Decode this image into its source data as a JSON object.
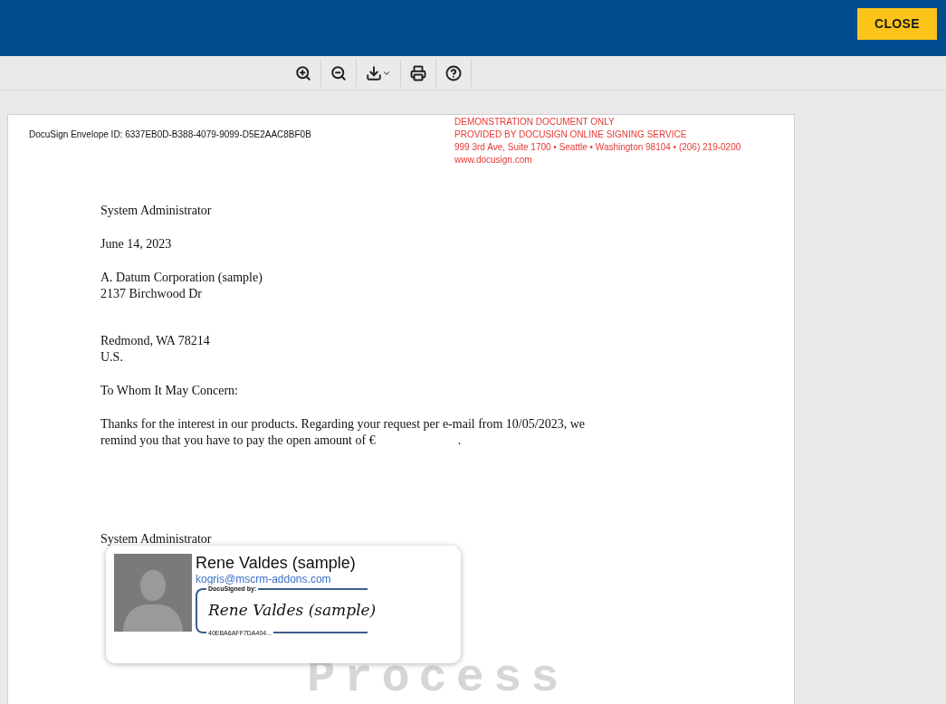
{
  "header": {
    "close_button": "CLOSE"
  },
  "toolbar": [
    {
      "kind": "zoom-in"
    },
    {
      "kind": "zoom-out"
    },
    {
      "kind": "download"
    },
    {
      "kind": "print"
    },
    {
      "kind": "help"
    }
  ],
  "document": {
    "envelope_id": "DocuSign Envelope ID: 6337EB0D-B388-4079-9099-D5E2AAC8BF0B",
    "demo_notice": [
      "DEMONSTRATION DOCUMENT ONLY",
      "PROVIDED BY DOCUSIGN ONLINE SIGNING SERVICE",
      "999 3rd Ave, Suite 1700  • Seattle • Washington 98104 • (206) 219-0200",
      "www.docusign.com"
    ],
    "sender": "System Administrator",
    "date": "June 14, 2023",
    "address": [
      "A. Datum Corporation (sample)",
      "2137 Birchwood Dr"
    ],
    "address_2": [
      "Redmond, WA 78214",
      "U.S."
    ],
    "salutation": "To Whom It May Concern:",
    "body": [
      "Thanks for the interest in our products. Regarding your request per e-mail from 10/05/2023, we",
      "remind you that you have to pay the open amount of €                          ."
    ],
    "closing": "System Administrator",
    "stamp": "Process"
  },
  "signer_card": {
    "name": "Rene Valdes (sample)",
    "email": "kogris@mscrm-addons.com",
    "signed_by_label": "DocuSigned by:",
    "signature": "Rene Valdes (sample)",
    "signature_id": "40EBA6AFF7DA404..."
  }
}
